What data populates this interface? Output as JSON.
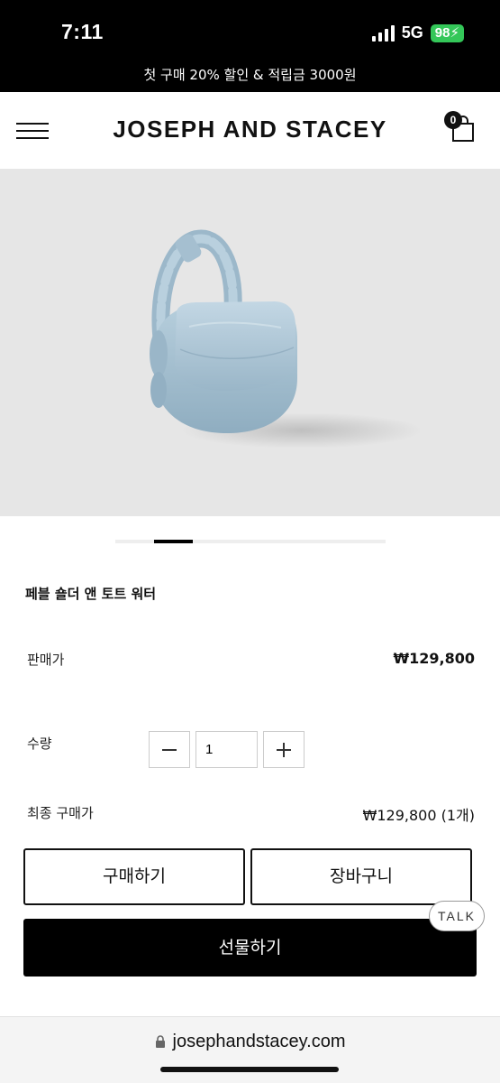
{
  "status_bar": {
    "time": "7:11",
    "network": "5G",
    "battery": "98"
  },
  "promo_banner": "첫 구매 20% 할인 & 적립금 3000원",
  "header": {
    "brand": "JOSEPH AND STACEY",
    "cart_count": "0"
  },
  "product": {
    "name": "페블 숄더 앤 토트 워터",
    "image_icon": "light-blue-shoulder-bag",
    "image_color": "#a9c3d4",
    "carousel": {
      "total_slides": 7,
      "active_slide": 2
    }
  },
  "price": {
    "label": "판매가",
    "value": "₩129,800"
  },
  "quantity": {
    "label": "수량",
    "value": "1",
    "minus_icon": "minus-icon",
    "plus_icon": "plus-icon"
  },
  "total": {
    "label": "최종 구매가",
    "value": "₩129,800 (1개)"
  },
  "buttons": {
    "buy": "구매하기",
    "cart": "장바구니",
    "gift": "선물하기"
  },
  "talk_button": "TALK",
  "browser": {
    "url": "josephandstacey.com",
    "lock_icon": "lock-icon"
  }
}
